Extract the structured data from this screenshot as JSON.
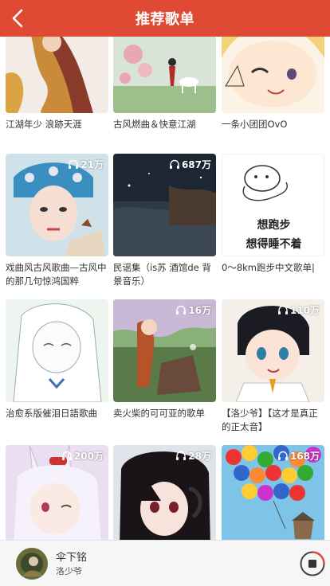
{
  "header": {
    "title": "推荐歌单",
    "back_icon": "chevron-left-icon"
  },
  "colors": {
    "accent": "#e04a35",
    "player_bg": "#f6f6f6"
  },
  "playlists": [
    {
      "caption": "江湖年少 浪跡天涯",
      "plays": ""
    },
    {
      "caption": "古风燃曲＆快意江湖",
      "plays": ""
    },
    {
      "caption": "一条小团团OvO",
      "plays": ""
    },
    {
      "caption": "戏曲风古风歌曲—古风中的那几句惊鸿国粹",
      "plays": "21万"
    },
    {
      "caption": "民谣集（is苏 酒馆de 背景音乐）",
      "plays": "687万"
    },
    {
      "caption": "0～8km跑步中文歌单|",
      "plays": "",
      "cover_text_1": "想跑步",
      "cover_text_2": "想得睡不着"
    },
    {
      "caption": "治愈系版催泪日語歌曲",
      "plays": ""
    },
    {
      "caption": "卖火柴的可可亚的歌单",
      "plays": "16万"
    },
    {
      "caption": "【洛少爷】【这才是真正的正太音】",
      "plays": "110万"
    },
    {
      "caption": "",
      "plays": "200万"
    },
    {
      "caption": "",
      "plays": "28万"
    },
    {
      "caption": "",
      "plays": "168万"
    }
  ],
  "player": {
    "title": "伞下铭",
    "artist": "洛少爷",
    "stop_icon": "stop-icon"
  }
}
